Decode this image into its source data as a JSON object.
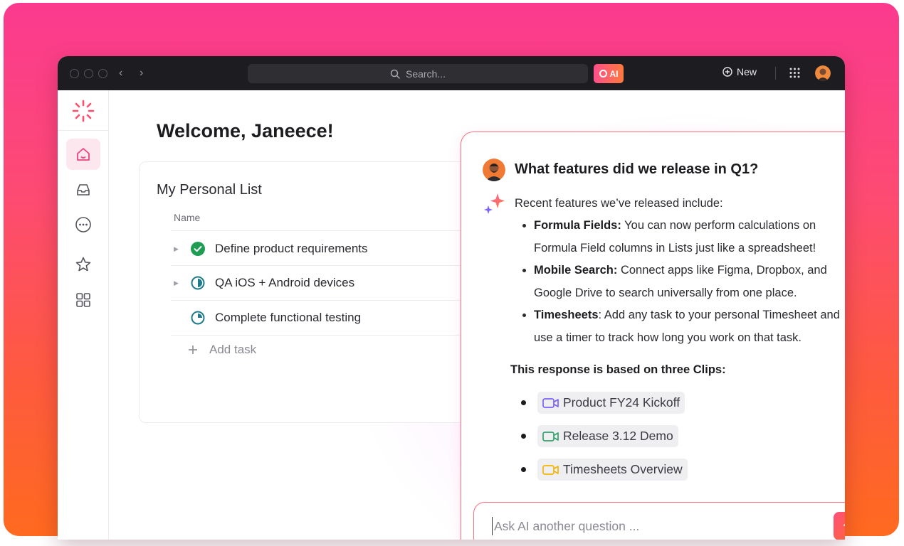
{
  "titlebar": {
    "search_placeholder": "Search...",
    "ai_label": "AI",
    "new_label": "New"
  },
  "sidebar": {
    "items": [
      {
        "name": "home",
        "icon": "home-icon",
        "active": true
      },
      {
        "name": "inbox",
        "icon": "inbox-icon",
        "active": false
      },
      {
        "name": "more",
        "icon": "more-dots-icon",
        "active": false
      },
      {
        "name": "favorites",
        "icon": "star-icon",
        "active": false
      },
      {
        "name": "spaces",
        "icon": "grid-icon",
        "active": false
      }
    ]
  },
  "main": {
    "welcome": "Welcome, Janeece!",
    "list": {
      "title": "My Personal List",
      "column_name": "Name",
      "tasks": [
        {
          "label": "Define product requirements",
          "status": "complete"
        },
        {
          "label": "QA iOS + Android devices",
          "status": "in-progress"
        },
        {
          "label": "Complete functional testing",
          "status": "in-progress"
        }
      ],
      "add_task": "Add task"
    }
  },
  "ai_panel": {
    "question": "What features did we release in Q1?",
    "intro": "Recent features we’ve released include:",
    "features": [
      {
        "title": "Formula Fields:",
        "text": " You can now perform calculations on Formula Field columns in Lists just like a spreadsheet!"
      },
      {
        "title": "Mobile Search:",
        "text": " Connect apps like Figma, Dropbox, and Google Drive to search universally from one place."
      },
      {
        "title": "Timesheets",
        "text": ": Add any task to your personal Timesheet and use a timer to track how long you work on that task."
      }
    ],
    "clips_heading": "This response is based on three Clips:",
    "clips": [
      {
        "label": "Product FY24 Kickoff",
        "color": "#7b61ff"
      },
      {
        "label": "Release 3.12 Demo",
        "color": "#2fa36b"
      },
      {
        "label": "Timesheets Overview",
        "color": "#f4b400"
      }
    ],
    "ask_placeholder": "Ask AI another question ..."
  },
  "colors": {
    "accent": "#fb6f7e",
    "send_gradient_start": "#ff4f7a",
    "send_gradient_end": "#ff6a2e"
  }
}
